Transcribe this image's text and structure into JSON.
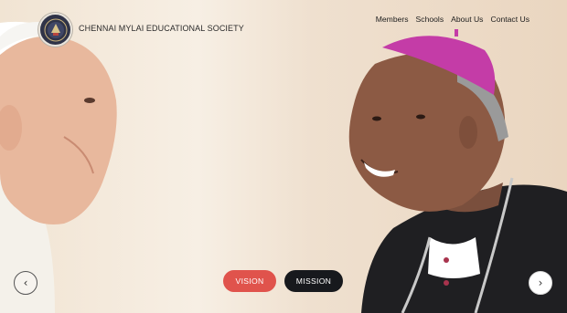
{
  "header": {
    "site_name": "CHENNAI MYLAI EDUCATIONAL SOCIETY",
    "logo_icon": "society-emblem-icon"
  },
  "nav": {
    "items": [
      {
        "label": "Members"
      },
      {
        "label": "Schools"
      },
      {
        "label": "About Us"
      },
      {
        "label": "Contact Us"
      }
    ]
  },
  "hero": {
    "image": "pope-and-bishop-photo",
    "buttons": {
      "vision": "VISION",
      "mission": "MISSION"
    },
    "prev_icon": "chevron-left-icon",
    "next_icon": "chevron-right-icon",
    "prev_glyph": "‹",
    "next_glyph": "›"
  },
  "colors": {
    "vision_button": "#e0534c",
    "mission_button": "#17191d",
    "logo_bg": "#2f3348"
  }
}
